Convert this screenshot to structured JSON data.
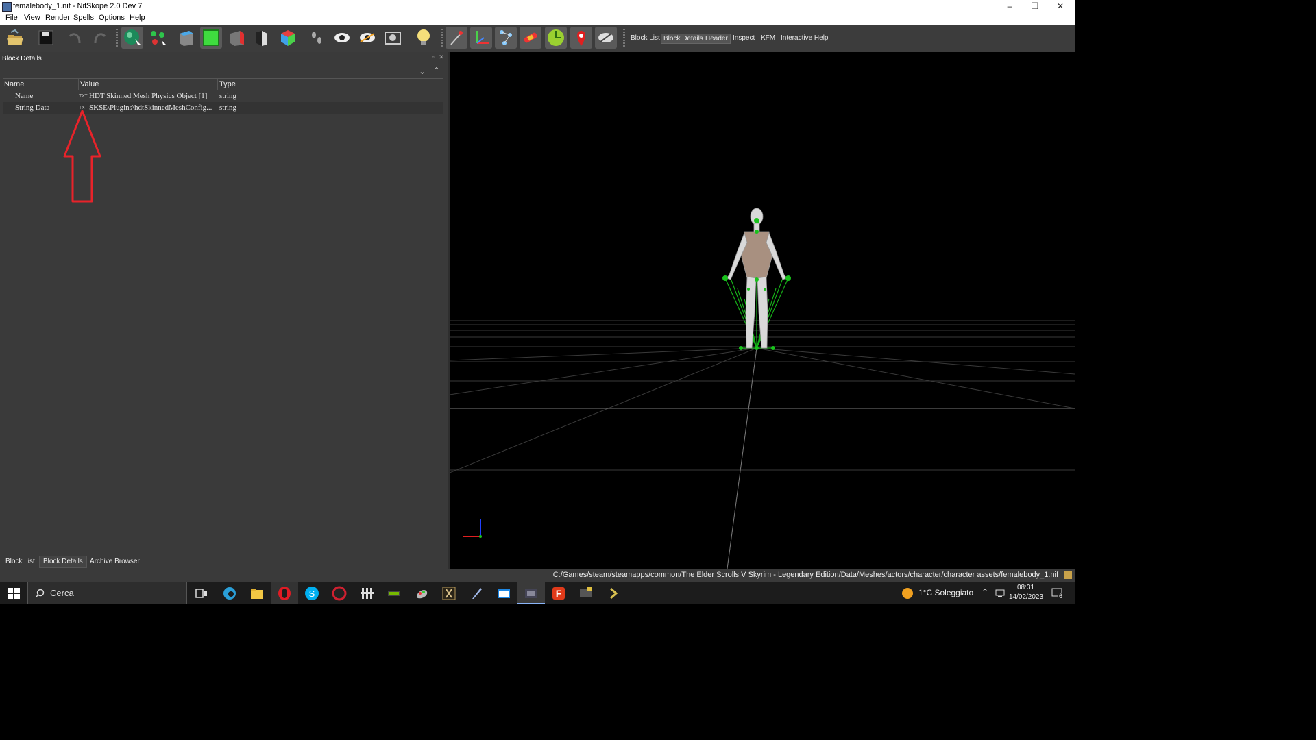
{
  "window": {
    "title": "femalebody_1.nif - NifSkope 2.0 Dev 7",
    "controls": [
      "–",
      "❐",
      "✕"
    ]
  },
  "menu": [
    "File",
    "View",
    "Render",
    "Spells",
    "Options",
    "Help"
  ],
  "toolbar": {
    "tabs": [
      "Block List",
      "Block Details",
      "Header",
      "Inspect",
      "KFM",
      "Interactive Help"
    ]
  },
  "panel": {
    "title": "Block Details",
    "columns": [
      "Name",
      "Value",
      "Type"
    ],
    "rows": [
      {
        "name": "Name",
        "value": "HDT Skinned Mesh Physics Object [1]",
        "type": "string"
      },
      {
        "name": "String Data",
        "value": "SKSE\\Plugins\\hdtSkinnedMeshConfig...",
        "type": "string"
      }
    ],
    "bottom_tabs": [
      "Block List",
      "Block Details",
      "Archive Browser"
    ],
    "annotation_color": "#e8232a"
  },
  "status": {
    "path": "C:/Games/steam/steamapps/common/The Elder Scrolls V Skyrim - Legendary Edition/Data/Meshes/actors/character/character assets/femalebody_1.nif"
  },
  "taskbar": {
    "search_placeholder": "Cerca",
    "weather": "1°C  Soleggiato",
    "time": "08:31",
    "date": "14/02/2023",
    "notifications": "6"
  },
  "colors": {
    "accent_green": "#19c21c",
    "panel_bg": "#3a3a3a",
    "viewport_bg": "#000000"
  }
}
